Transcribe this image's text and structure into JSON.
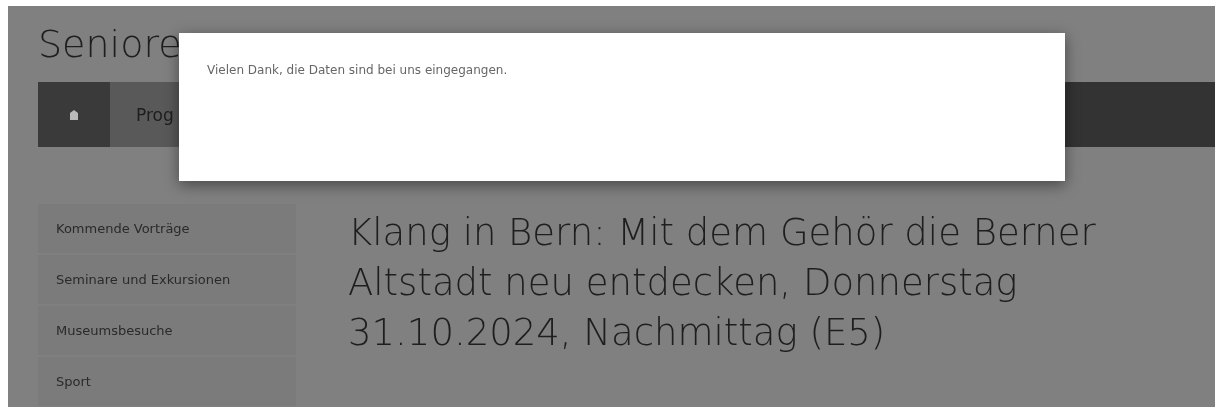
{
  "site_title": "Seniore",
  "nav": {
    "items": [
      {
        "kind": "home",
        "selected": false
      },
      {
        "kind": "text",
        "label": "Prog",
        "selected": true
      }
    ]
  },
  "sidebar": {
    "items": [
      {
        "label": "Kommende Vorträge"
      },
      {
        "label": "Seminare und Exkursionen"
      },
      {
        "label": "Museumsbesuche"
      },
      {
        "label": "Sport"
      }
    ]
  },
  "headline": "Klang in Bern: Mit dem Gehör die Berner Altstadt neu entdecken, Donnerstag 31.10.2024, Nachmittag (E5)",
  "dialog": {
    "message": "Vielen Dank, die Daten sind bei uns eingegangen."
  }
}
